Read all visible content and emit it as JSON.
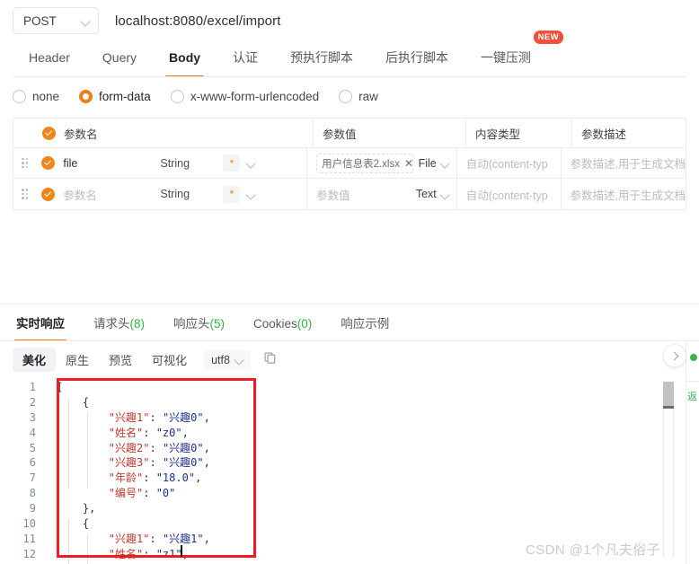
{
  "request": {
    "method": "POST",
    "url": "localhost:8080/excel/import",
    "tabs": [
      {
        "label": "Header",
        "active": false,
        "badge": null
      },
      {
        "label": "Query",
        "active": false,
        "badge": null
      },
      {
        "label": "Body",
        "active": true,
        "badge": null
      },
      {
        "label": "认证",
        "active": false,
        "badge": null
      },
      {
        "label": "预执行脚本",
        "active": false,
        "badge": null
      },
      {
        "label": "后执行脚本",
        "active": false,
        "badge": null
      },
      {
        "label": "一键压测",
        "active": false,
        "badge": "NEW"
      }
    ],
    "body_types": [
      {
        "label": "none",
        "selected": false
      },
      {
        "label": "form-data",
        "selected": true
      },
      {
        "label": "x-www-form-urlencoded",
        "selected": false
      },
      {
        "label": "raw",
        "selected": false
      }
    ]
  },
  "param_table": {
    "headers": {
      "name": "参数名",
      "value": "参数值",
      "content_type": "内容类型",
      "description": "参数描述"
    },
    "rows": [
      {
        "enabled": true,
        "name": "file",
        "name_is_placeholder": false,
        "data_type": "String",
        "required_mark": "*",
        "file_chip": "用户信息表2.xlsx",
        "value_placeholder": null,
        "value_type": "File",
        "content_type": "自动(content-typ",
        "description": "参数描述,用于生成文档"
      },
      {
        "enabled": true,
        "name": "参数名",
        "name_is_placeholder": true,
        "data_type": "String",
        "required_mark": "*",
        "file_chip": null,
        "value_placeholder": "参数值",
        "value_type": "Text",
        "content_type": "自动(content-typ",
        "description": "参数描述,用于生成文档"
      }
    ]
  },
  "response": {
    "tabs": [
      {
        "label": "实时响应",
        "count": null,
        "active": true
      },
      {
        "label": "请求头",
        "count": "(8)",
        "active": false
      },
      {
        "label": "响应头",
        "count": "(5)",
        "active": false
      },
      {
        "label": "Cookies",
        "count": "(0)",
        "active": false
      },
      {
        "label": "响应示例",
        "count": null,
        "active": false
      }
    ],
    "view_tabs": [
      {
        "label": "美化",
        "active": true
      },
      {
        "label": "原生",
        "active": false
      },
      {
        "label": "预览",
        "active": false
      },
      {
        "label": "可视化",
        "active": false
      }
    ],
    "encoding": "utf8",
    "copy_icon": "copy-icon",
    "rail_label": "返",
    "status_dot_color": "#3bb54a"
  },
  "code": {
    "line_numbers": [
      "1",
      "2",
      "3",
      "4",
      "5",
      "6",
      "7",
      "8",
      "9",
      "10",
      "11",
      "12"
    ],
    "lines": [
      [
        {
          "t": "p",
          "s": "["
        }
      ],
      [
        {
          "t": "p",
          "s": "    {"
        }
      ],
      [
        {
          "t": "k",
          "s": "        \"兴趣1\""
        },
        {
          "t": "p",
          "s": ": "
        },
        {
          "t": "v",
          "s": "\"兴趣0\""
        },
        {
          "t": "p",
          "s": ","
        }
      ],
      [
        {
          "t": "k",
          "s": "        \"姓名\""
        },
        {
          "t": "p",
          "s": ": "
        },
        {
          "t": "v",
          "s": "\"z0\""
        },
        {
          "t": "p",
          "s": ","
        }
      ],
      [
        {
          "t": "k",
          "s": "        \"兴趣2\""
        },
        {
          "t": "p",
          "s": ": "
        },
        {
          "t": "v",
          "s": "\"兴趣0\""
        },
        {
          "t": "p",
          "s": ","
        }
      ],
      [
        {
          "t": "k",
          "s": "        \"兴趣3\""
        },
        {
          "t": "p",
          "s": ": "
        },
        {
          "t": "v",
          "s": "\"兴趣0\""
        },
        {
          "t": "p",
          "s": ","
        }
      ],
      [
        {
          "t": "k",
          "s": "        \"年龄\""
        },
        {
          "t": "p",
          "s": ": "
        },
        {
          "t": "v",
          "s": "\"18.0\""
        },
        {
          "t": "p",
          "s": ","
        }
      ],
      [
        {
          "t": "k",
          "s": "        \"编号\""
        },
        {
          "t": "p",
          "s": ": "
        },
        {
          "t": "v",
          "s": "\"0\""
        }
      ],
      [
        {
          "t": "p",
          "s": "    },"
        }
      ],
      [
        {
          "t": "p",
          "s": "    {"
        }
      ],
      [
        {
          "t": "k",
          "s": "        \"兴趣1\""
        },
        {
          "t": "p",
          "s": ": "
        },
        {
          "t": "v",
          "s": "\"兴趣1\""
        },
        {
          "t": "p",
          "s": ","
        }
      ],
      [
        {
          "t": "k",
          "s": "        \"姓名\""
        },
        {
          "t": "p",
          "s": ": "
        },
        {
          "t": "v",
          "s": "\"z1\""
        },
        {
          "t": "p",
          "s": ","
        }
      ]
    ]
  },
  "watermark": "CSDN @1个凡夫俗子",
  "colors": {
    "accent": "#ef7d1a",
    "check": "#f08519",
    "badge_new": "#f0503c",
    "count_green": "#2fb344",
    "annotation_red": "#ee1c25",
    "json_key": "#c0392b",
    "json_value": "#1d2f8f"
  }
}
